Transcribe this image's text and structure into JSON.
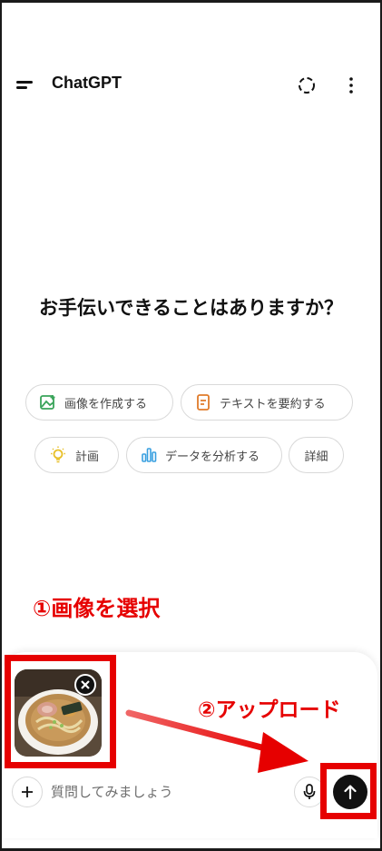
{
  "header": {
    "title": "ChatGPT",
    "menu_icon": "menu-icon",
    "temp_chat_icon": "dashed-circle-icon",
    "more_icon": "more-vertical-icon"
  },
  "main": {
    "greeting": "お手伝いできることはありますか？",
    "suggestions": [
      {
        "label": "画像を作成する",
        "icon": "image-icon",
        "color": "#3aa45a"
      },
      {
        "label": "テキストを要約する",
        "icon": "document-icon",
        "color": "#e07b2a"
      },
      {
        "label": "計画",
        "icon": "lightbulb-icon",
        "color": "#e8c02a"
      },
      {
        "label": "データを分析する",
        "icon": "bar-chart-icon",
        "color": "#3aa0e0"
      },
      {
        "label": "詳細",
        "icon": "",
        "color": "#444444"
      }
    ]
  },
  "annotations": {
    "step1": "①画像を選択",
    "step2": "②アップロード",
    "color": "#e60000"
  },
  "composer": {
    "placeholder": "質問してみましょう",
    "add_icon": "plus-icon",
    "mic_icon": "microphone-icon",
    "send_icon": "arrow-up-icon",
    "attachment_icon": "ramen-photo-thumbnail",
    "remove_icon": "close-icon"
  }
}
